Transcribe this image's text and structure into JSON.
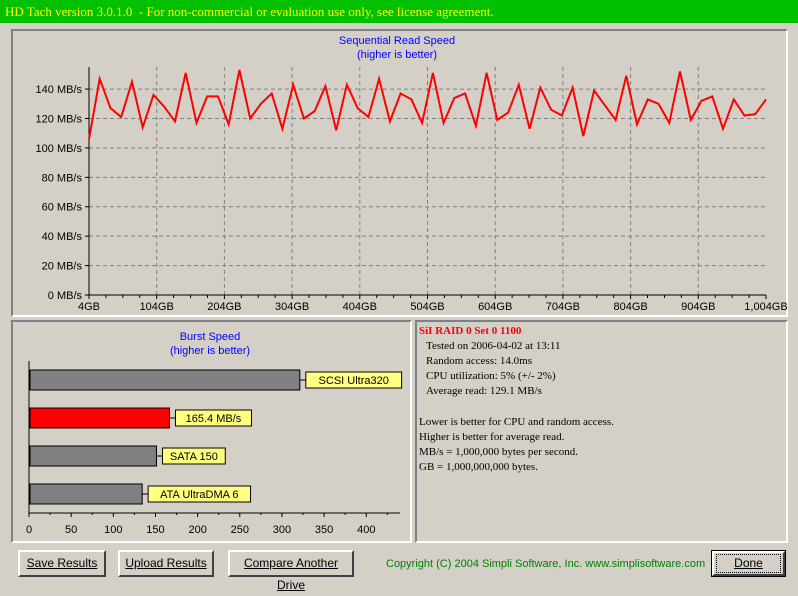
{
  "window": {
    "title": "HD Tach version 3.0.1.0  - For non-commercial or evaluation use only, see license agreement."
  },
  "colors": {
    "titlebar_bg": "#00c000",
    "titlebar_text": "#ffff00",
    "chart_title": "#0000ff",
    "read_line": "#ff0000",
    "highlight_bar": "#ff0000",
    "reference_bar": "#808080",
    "label_bg": "#ffff80",
    "drive_name": "#ff0000",
    "copyright": "#008000"
  },
  "chart_data": [
    {
      "type": "line",
      "title": "Sequential Read Speed",
      "subtitle": "(higher is better)",
      "xlabel": "",
      "ylabel": "",
      "y_tick_labels": [
        "0 MB/s",
        "20 MB/s",
        "40 MB/s",
        "60 MB/s",
        "80 MB/s",
        "100 MB/s",
        "120 MB/s",
        "140 MB/s"
      ],
      "y_ticks": [
        0,
        20,
        40,
        60,
        80,
        100,
        120,
        140
      ],
      "x_tick_labels": [
        "4GB",
        "104GB",
        "204GB",
        "304GB",
        "404GB",
        "504GB",
        "604GB",
        "704GB",
        "804GB",
        "904GB",
        "1,004GB"
      ],
      "ylim": [
        0,
        155
      ],
      "grid": true,
      "series": [
        {
          "values": [
            106,
            147,
            127,
            121,
            145,
            114,
            136,
            128,
            118,
            151,
            117,
            135,
            135,
            116,
            153,
            120,
            130,
            137,
            113,
            143,
            120,
            125,
            142,
            112,
            143,
            127,
            121,
            147,
            118,
            137,
            133,
            117,
            151,
            117,
            134,
            137,
            115,
            151,
            119,
            124,
            143,
            113,
            141,
            126,
            122,
            141,
            108,
            139,
            129,
            119,
            149,
            116,
            133,
            130,
            117,
            152,
            119,
            132,
            135,
            113,
            133,
            122,
            123,
            133
          ]
        }
      ]
    },
    {
      "type": "bar",
      "title": "Burst Speed",
      "subtitle": "(higher is better)",
      "xlabel": "",
      "ylabel": "",
      "x_tick_labels": [
        "0",
        "50",
        "100",
        "150",
        "200",
        "250",
        "300",
        "350",
        "400"
      ],
      "xlim": [
        0,
        440
      ],
      "categories": [
        "SCSI Ultra320",
        "165.4 MB/s",
        "SATA 150",
        "ATA UltraDMA 6"
      ],
      "values": [
        320,
        165.4,
        150,
        133
      ],
      "highlighted_index": 1
    }
  ],
  "info": {
    "drive_name": "SiI RAID 0 Set 0 1100",
    "tested": "Tested on 2006-04-02 at 13:11",
    "random_access": "Random access: 14.0ms",
    "cpu": "CPU utilization: 5% (+/- 2%)",
    "average_read": "Average read: 129.1 MB/s",
    "note1": "Lower is better for CPU and random access.",
    "note2": "Higher is better for average read.",
    "note3": "MB/s = 1,000,000 bytes per second.",
    "note4": "GB = 1,000,000,000 bytes."
  },
  "buttons": {
    "save": "Save Results",
    "upload": "Upload Results",
    "compare": "Compare Another Drive",
    "done": "Done"
  },
  "footer": {
    "copyright": "Copyright (C) 2004 Simpli Software, Inc. www.simplisoftware.com"
  }
}
